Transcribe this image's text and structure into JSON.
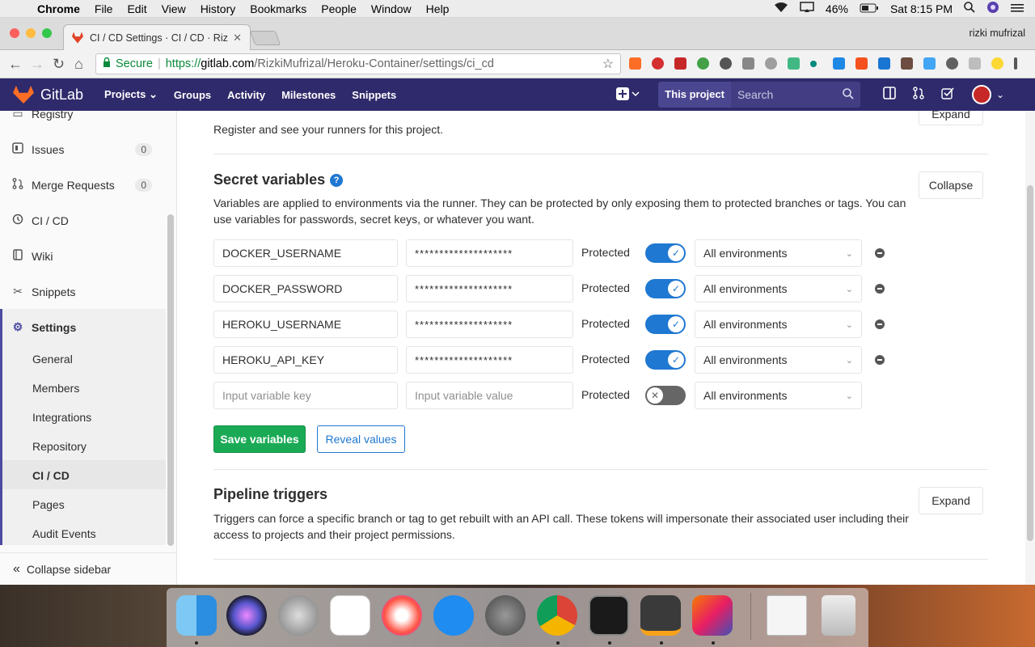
{
  "menubar": {
    "app": "Chrome",
    "items": [
      "File",
      "Edit",
      "View",
      "History",
      "Bookmarks",
      "People",
      "Window",
      "Help"
    ],
    "battery": "46%",
    "clock": "Sat 8:15 PM"
  },
  "browser": {
    "tab_title": "CI / CD Settings · CI / CD · Rizki",
    "profile": "rizki mufrizal",
    "secure_label": "Secure",
    "url_scheme": "https://",
    "url_host": "gitlab.com",
    "url_path": "/RizkiMufrizal/Heroku-Container/settings/ci_cd"
  },
  "gitlab_nav": {
    "brand": "GitLab",
    "links": [
      "Projects",
      "Groups",
      "Activity",
      "Milestones",
      "Snippets"
    ],
    "this_project": "This project",
    "search_placeholder": "Search"
  },
  "sidebar": {
    "items": [
      {
        "label": "Registry",
        "icon": "registry-icon"
      },
      {
        "label": "Issues",
        "icon": "issues-icon",
        "count": "0"
      },
      {
        "label": "Merge Requests",
        "icon": "merge-request-icon",
        "count": "0"
      },
      {
        "label": "CI / CD",
        "icon": "rocket-icon"
      },
      {
        "label": "Wiki",
        "icon": "book-icon"
      },
      {
        "label": "Snippets",
        "icon": "scissors-icon"
      },
      {
        "label": "Settings",
        "icon": "gear-icon"
      }
    ],
    "settings_sub": [
      "General",
      "Members",
      "Integrations",
      "Repository",
      "CI / CD",
      "Pages",
      "Audit Events"
    ],
    "active_sub": "CI / CD",
    "collapse_label": "Collapse sidebar"
  },
  "runners": {
    "desc": "Register and see your runners for this project.",
    "button": "Expand"
  },
  "secret_variables": {
    "title": "Secret variables",
    "desc": "Variables are applied to environments via the runner. They can be protected by only exposing them to protected branches or tags. You can use variables for passwords, secret keys, or whatever you want.",
    "button": "Collapse",
    "protected_label": "Protected",
    "rows": [
      {
        "key": "DOCKER_USERNAME",
        "value": "********************",
        "protected": true,
        "environment": "All environments"
      },
      {
        "key": "DOCKER_PASSWORD",
        "value": "********************",
        "protected": true,
        "environment": "All environments"
      },
      {
        "key": "HEROKU_USERNAME",
        "value": "********************",
        "protected": true,
        "environment": "All environments"
      },
      {
        "key": "HEROKU_API_KEY",
        "value": "********************",
        "protected": true,
        "environment": "All environments"
      }
    ],
    "new_row": {
      "key_placeholder": "Input variable key",
      "value_placeholder": "Input variable value",
      "protected": false,
      "environment": "All environments"
    },
    "save_button": "Save variables",
    "reveal_button": "Reveal values"
  },
  "pipeline_triggers": {
    "title": "Pipeline triggers",
    "desc": "Triggers can force a specific branch or tag to get rebuilt with an API call. These tokens will impersonate their associated user including their access to projects and their project permissions.",
    "button": "Expand"
  },
  "colors": {
    "nav_bg": "#2f2a6b",
    "primary_blue": "#1f78d1",
    "save_green": "#1aaa55"
  }
}
